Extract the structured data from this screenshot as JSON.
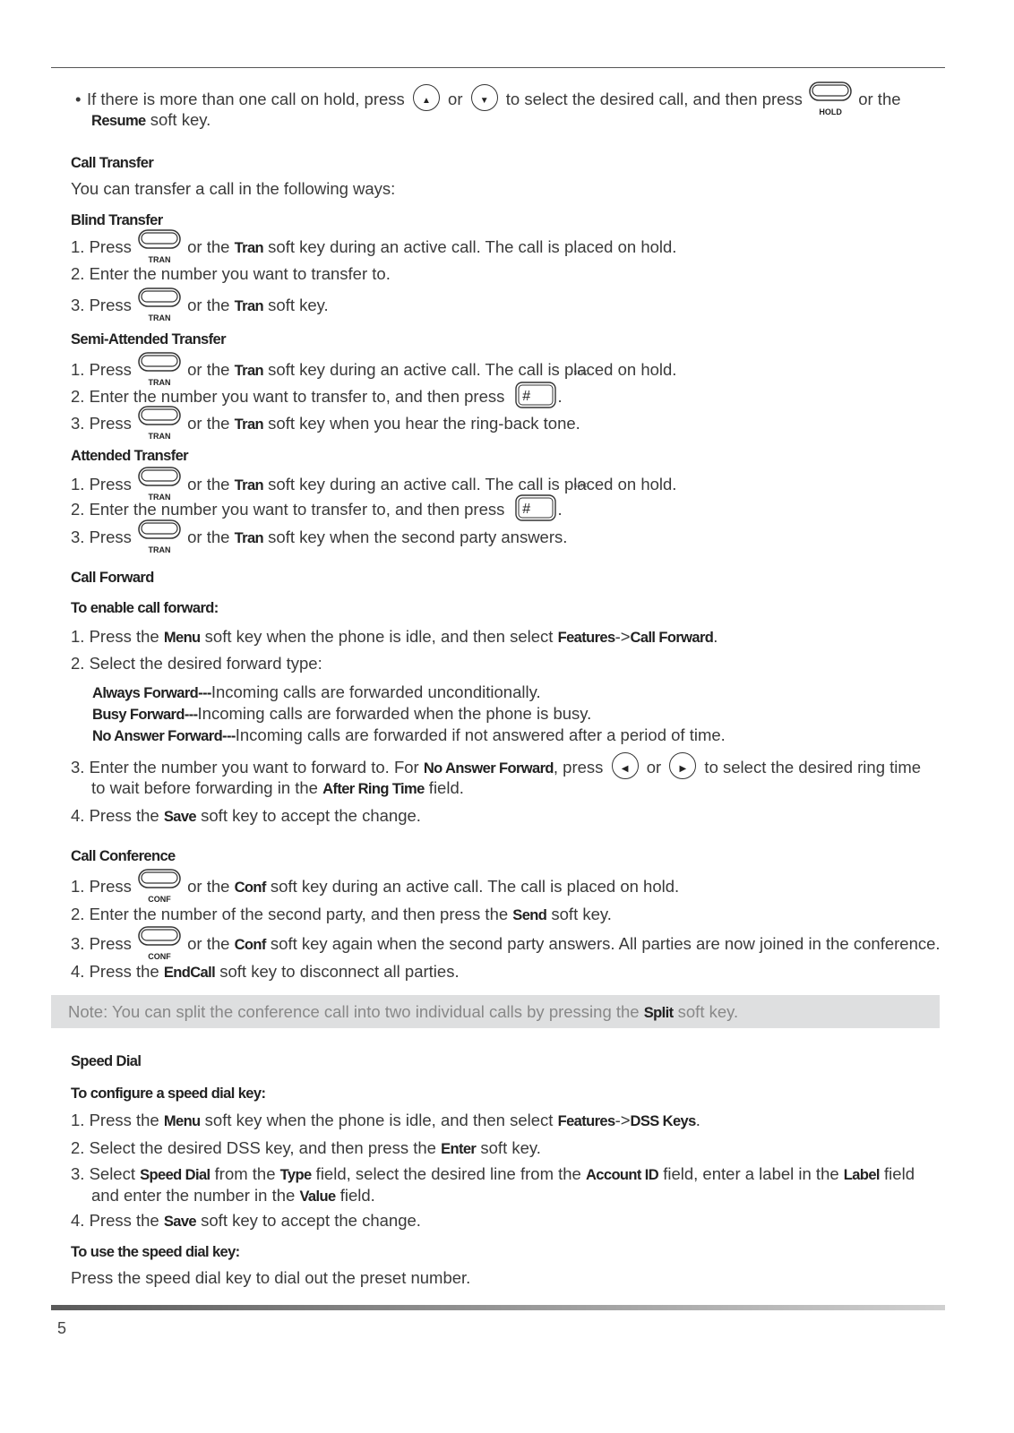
{
  "page_number": "5",
  "note": {
    "label": "Note:",
    "segs": [
      {
        "t": " You can split the conference call into two individual calls by pressing the "
      },
      {
        "b": "Split"
      },
      {
        "t": " soft key."
      }
    ]
  },
  "lines": [
    {
      "k": "bullet",
      "segs": [
        {
          "t": "If there is more than one call on hold, press "
        },
        {
          "nav": "up"
        },
        {
          "t": " or "
        },
        {
          "nav": "down"
        },
        {
          "t": " to select the desired call, and then press "
        },
        {
          "key": "HOLD"
        },
        {
          "t": " or the"
        }
      ]
    },
    {
      "k": "cont",
      "segs": [
        {
          "b": "Resume"
        },
        {
          "t": " soft key."
        }
      ]
    },
    {
      "k": "h",
      "segs": [
        {
          "b": "Call Transfer"
        }
      ]
    },
    {
      "k": "p",
      "segs": [
        {
          "t": "You can transfer a call in the following ways:"
        }
      ]
    },
    {
      "k": "h",
      "segs": [
        {
          "b": "Blind Transfer"
        }
      ]
    },
    {
      "k": "p",
      "segs": [
        {
          "t": "1. Press "
        },
        {
          "key": "TRAN"
        },
        {
          "t": " or the "
        },
        {
          "b": "Tran"
        },
        {
          "t": " soft key during an active call. The call is placed on hold."
        }
      ]
    },
    {
      "k": "p",
      "segs": [
        {
          "t": "2. Enter the number you want to transfer to."
        }
      ]
    },
    {
      "k": "p",
      "segs": [
        {
          "t": "3. Press "
        },
        {
          "key": "TRAN"
        },
        {
          "t": " or the "
        },
        {
          "b": "Tran"
        },
        {
          "t": " soft key."
        }
      ]
    },
    {
      "k": "h",
      "segs": [
        {
          "b": "Semi-Attended Transfer"
        }
      ]
    },
    {
      "k": "p",
      "segs": [
        {
          "t": "1. Press "
        },
        {
          "key": "TRAN"
        },
        {
          "t": " or the "
        },
        {
          "b": "Tran"
        },
        {
          "t": " soft key during an active call. The call is placed on hold."
        }
      ]
    },
    {
      "k": "p",
      "segs": [
        {
          "t": "2. Enter the number you want to transfer to, and then press "
        },
        {
          "send": "SEND"
        },
        {
          "t": "."
        }
      ]
    },
    {
      "k": "p",
      "segs": [
        {
          "t": "3. Press "
        },
        {
          "key": "TRAN"
        },
        {
          "t": " or the "
        },
        {
          "b": "Tran"
        },
        {
          "t": " soft key when you hear the ring-back tone."
        }
      ]
    },
    {
      "k": "h",
      "segs": [
        {
          "b": "Attended Transfer"
        }
      ]
    },
    {
      "k": "p",
      "segs": [
        {
          "t": "1. Press "
        },
        {
          "key": "TRAN"
        },
        {
          "t": " or the "
        },
        {
          "b": "Tran"
        },
        {
          "t": " soft key during an active call. The call is placed on hold."
        }
      ]
    },
    {
      "k": "p",
      "segs": [
        {
          "t": "2. Enter the number you want to transfer to, and then press "
        },
        {
          "send": "SEND"
        },
        {
          "t": "."
        }
      ]
    },
    {
      "k": "p",
      "segs": [
        {
          "t": "3. Press "
        },
        {
          "key": "TRAN"
        },
        {
          "t": " or the "
        },
        {
          "b": "Tran"
        },
        {
          "t": " soft key when the second party answers."
        }
      ]
    },
    {
      "k": "h",
      "segs": [
        {
          "b": "Call Forward"
        }
      ]
    },
    {
      "k": "h",
      "segs": [
        {
          "b": "To enable call forward:"
        }
      ]
    },
    {
      "k": "p",
      "segs": [
        {
          "t": "1. Press the "
        },
        {
          "b": "Menu"
        },
        {
          "t": " soft key when the phone is idle, and then select "
        },
        {
          "b": "Features"
        },
        {
          "t": "->"
        },
        {
          "b": "Call Forward"
        },
        {
          "t": "."
        }
      ]
    },
    {
      "k": "p",
      "segs": [
        {
          "t": "2. Select the desired forward type:"
        }
      ]
    },
    {
      "k": "sub",
      "segs": [
        {
          "b": "Always Forward---"
        },
        {
          "t": "Incoming calls are forwarded unconditionally."
        }
      ]
    },
    {
      "k": "sub",
      "segs": [
        {
          "b": "Busy Forward---"
        },
        {
          "t": "Incoming calls are forwarded when the phone is busy."
        }
      ]
    },
    {
      "k": "sub",
      "segs": [
        {
          "b": "No Answer Forward---"
        },
        {
          "t": "Incoming calls are forwarded if not answered after a period of time."
        }
      ]
    },
    {
      "k": "p",
      "segs": [
        {
          "t": "3. Enter the number you want to forward to. For "
        },
        {
          "b": "No Answer Forward"
        },
        {
          "t": ", press "
        },
        {
          "nav": "left"
        },
        {
          "t": " or "
        },
        {
          "nav": "right"
        },
        {
          "t": " to select the desired ring time"
        }
      ]
    },
    {
      "k": "cont",
      "segs": [
        {
          "t": "to wait before forwarding in the "
        },
        {
          "b": "After Ring Time"
        },
        {
          "t": " field."
        }
      ]
    },
    {
      "k": "p",
      "segs": [
        {
          "t": "4. Press the "
        },
        {
          "b": "Save"
        },
        {
          "t": " soft key to accept the change."
        }
      ]
    },
    {
      "k": "h",
      "segs": [
        {
          "b": "Call Conference"
        }
      ]
    },
    {
      "k": "p",
      "segs": [
        {
          "t": "1. Press "
        },
        {
          "key": "CONF"
        },
        {
          "t": " or the "
        },
        {
          "b": "Conf"
        },
        {
          "t": " soft key during an active call. The call is placed on hold."
        }
      ]
    },
    {
      "k": "p",
      "segs": [
        {
          "t": "2. Enter the number of the second party, and then press the "
        },
        {
          "b": "Send"
        },
        {
          "t": " soft key."
        }
      ]
    },
    {
      "k": "p",
      "segs": [
        {
          "t": "3. Press "
        },
        {
          "key": "CONF"
        },
        {
          "t": " or the "
        },
        {
          "b": "Conf"
        },
        {
          "t": " soft key again when the second party answers. All parties are now joined in the conference."
        }
      ]
    },
    {
      "k": "p",
      "segs": [
        {
          "t": "4. Press the "
        },
        {
          "b": "EndCall"
        },
        {
          "t": " soft key to disconnect all parties."
        }
      ]
    },
    {
      "k": "h",
      "segs": [
        {
          "b": "Speed Dial"
        }
      ]
    },
    {
      "k": "h",
      "segs": [
        {
          "b": "To configure a speed dial key:"
        }
      ]
    },
    {
      "k": "p",
      "segs": [
        {
          "t": "1. Press the "
        },
        {
          "b": "Menu"
        },
        {
          "t": " soft key when the phone is idle, and then select "
        },
        {
          "b": "Features"
        },
        {
          "t": "->"
        },
        {
          "b": "DSS Keys"
        },
        {
          "t": "."
        }
      ]
    },
    {
      "k": "p",
      "segs": [
        {
          "t": "2. Select the desired DSS key, and then press the "
        },
        {
          "b": "Enter"
        },
        {
          "t": " soft key."
        }
      ]
    },
    {
      "k": "p",
      "segs": [
        {
          "t": "3. Select "
        },
        {
          "b": "Speed Dial"
        },
        {
          "t": " from the "
        },
        {
          "b": "Type"
        },
        {
          "t": " field, select the desired line from the "
        },
        {
          "b": "Account ID"
        },
        {
          "t": " field, enter a label in the "
        },
        {
          "b": "Label"
        },
        {
          "t": " field"
        }
      ]
    },
    {
      "k": "cont",
      "segs": [
        {
          "t": "and enter the number in the "
        },
        {
          "b": "Value"
        },
        {
          "t": " field."
        }
      ]
    },
    {
      "k": "p",
      "segs": [
        {
          "t": "4. Press the "
        },
        {
          "b": "Save"
        },
        {
          "t": " soft key to accept the change."
        }
      ]
    },
    {
      "k": "h",
      "segs": [
        {
          "b": "To use the speed dial key:"
        }
      ]
    },
    {
      "k": "p",
      "segs": [
        {
          "t": "Press the speed dial key to dial out the preset number."
        }
      ]
    }
  ]
}
